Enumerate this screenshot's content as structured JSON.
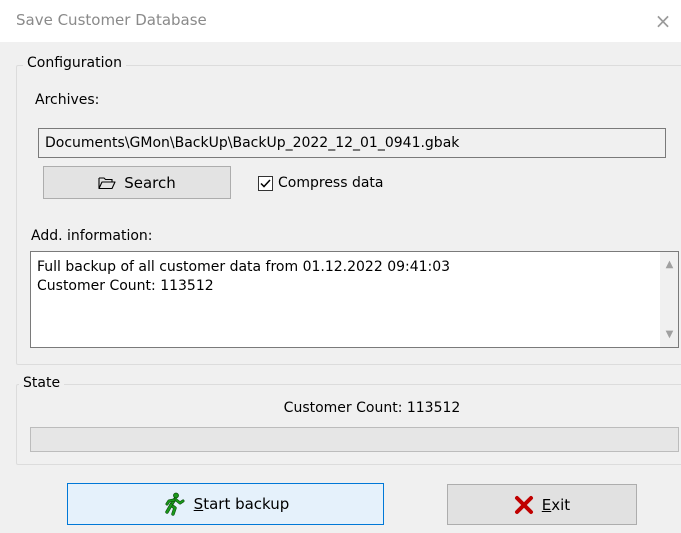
{
  "window": {
    "title": "Save Customer Database",
    "close_glyph": "×"
  },
  "configuration": {
    "legend": "Configuration",
    "archives_label": "Archives:",
    "archive_path": "Documents\\GMon\\BackUp\\BackUp_2022_12_01_0941.gbak",
    "search_label": "Search",
    "compress_label": "Compress data",
    "compress_checked": true,
    "add_info_label": "Add. information:",
    "add_info_lines": [
      "Full backup of all customer data from 01.12.2022 09:41:03",
      "Customer Count: 113512"
    ]
  },
  "state": {
    "legend": "State",
    "status_text": "Customer Count: 113512",
    "progress": 0
  },
  "footer": {
    "start_first": "S",
    "start_rest": "tart backup",
    "exit_first": "E",
    "exit_rest": "xit"
  },
  "icons": {
    "search": "folder-open-icon",
    "start": "running-man-icon",
    "exit": "red-x-icon"
  },
  "colors": {
    "focus_border": "#0078d7",
    "focus_bg": "#e5f1fb",
    "exit_icon": "#c00000",
    "start_icon": "#1a9a1a"
  }
}
